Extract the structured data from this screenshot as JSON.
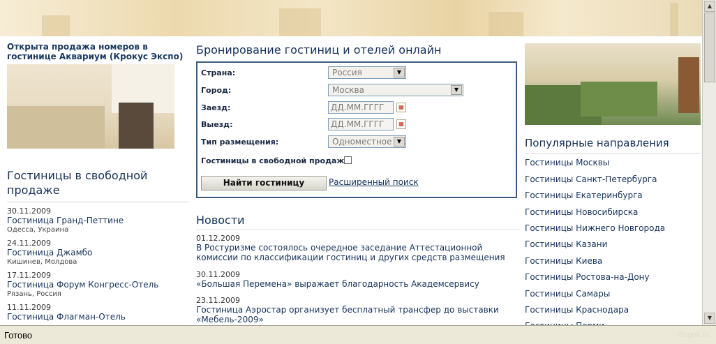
{
  "promo": {
    "title": "Открыта продажа номеров в гостинице Аквариум (Крокус Экспо)"
  },
  "hot": {
    "heading": "Гостиницы в свободной продаже",
    "items": [
      {
        "date": "30.11.2009",
        "name": "Гостиница Гранд-Петтине",
        "location": "Одесса, Украина"
      },
      {
        "date": "24.11.2009",
        "name": "Гостиница Джамбо",
        "location": "Кишинев, Молдова"
      },
      {
        "date": "17.11.2009",
        "name": "Гостиница Форум Конгресс-Отель",
        "location": "Рязань, Россия"
      },
      {
        "date": "11.11.2009",
        "name": "Гостиница Флагман-Отель",
        "location": ""
      }
    ]
  },
  "booking": {
    "title": "Бронирование гостиниц и отелей онлайн",
    "country_label": "Страна:",
    "country_value": "Россия",
    "city_label": "Город:",
    "city_value": "Москва",
    "checkin_label": "Заезд:",
    "checkin_value": "ДД.ММ.ГГГГ",
    "checkout_label": "Выезд:",
    "checkout_value": "ДД.ММ.ГГГГ",
    "room_type_label": "Тип размещения:",
    "room_type_value": "Одноместное",
    "free_sale_label": "Гостиницы в свободной продаже",
    "free_sale_checked": false,
    "search_button": "Найти гостиницу",
    "advanced_link": "Расширенный поиск"
  },
  "news": {
    "heading": "Новости",
    "items": [
      {
        "date": "01.12.2009",
        "text": "В Ростуризме состоялось очередное заседание Аттестационной комиссии по классификации гостиниц и других средств размещения"
      },
      {
        "date": "30.11.2009",
        "text": "«Большая Перемена» выражает благодарность Академсервису"
      },
      {
        "date": "23.11.2009",
        "text": "Гостиница Аэростар организует бесплатный трансфер до выставки «Мебель-2009»"
      }
    ]
  },
  "popular": {
    "heading": "Популярные направления",
    "items": [
      "Гостиницы Москвы",
      "Гостиницы Санкт-Петербурга",
      "Гостиницы Екатеринбурга",
      "Гостиницы Новосибирска",
      "Гостиницы Нижнего Новгорода",
      "Гостиницы Казани",
      "Гостиницы Киева",
      "Гостиницы Ростова-на-Дону",
      "Гостиницы Самары",
      "Гостиницы Краснодара",
      "Гостиницы Перми"
    ]
  },
  "statusbar": {
    "text": "Готово",
    "brand": "Gogek.ru"
  }
}
